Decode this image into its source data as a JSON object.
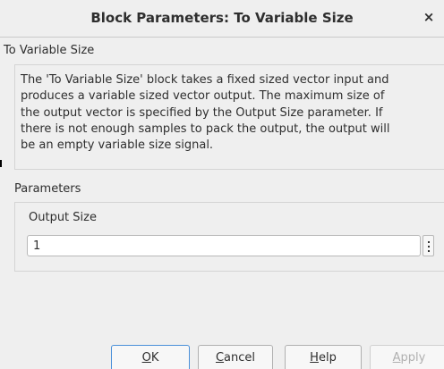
{
  "window": {
    "title": "Block Parameters: To Variable Size",
    "close_glyph": "×"
  },
  "block": {
    "name": "To Variable Size",
    "description_lines": [
      "The 'To Variable Size' block takes a fixed sized vector input and",
      "produces a variable sized vector output. The maximum size of",
      "the output vector is specified by the Output Size parameter. If",
      "there is not enough samples to pack the output, the output will",
      "be an empty variable size signal."
    ]
  },
  "parameters": {
    "section_label": "Parameters",
    "output_size": {
      "label": "Output Size",
      "value": "1"
    }
  },
  "buttons": {
    "ok": {
      "mnemonic": "O",
      "rest": "K",
      "enabled": true
    },
    "cancel": {
      "mnemonic": "C",
      "rest": "ancel",
      "enabled": true
    },
    "help": {
      "mnemonic": "H",
      "rest": "elp",
      "enabled": true
    },
    "apply": {
      "mnemonic": "A",
      "rest": "pply",
      "enabled": false
    }
  },
  "colors": {
    "background": "#efefef",
    "focus_border": "#4a90d9",
    "disabled_text": "#b0b0b0"
  }
}
